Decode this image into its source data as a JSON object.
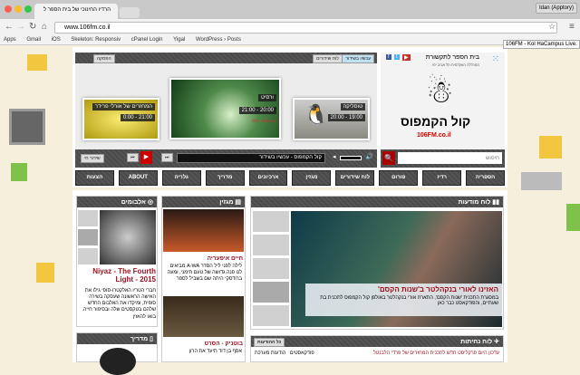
{
  "browser": {
    "tab_title": "הרדיו החינוכי של בית הספר ל",
    "user": "Idan (Apptory)",
    "url": "www.106fm.co.il",
    "tooltip": "106FM - Kol HaCampus Live.",
    "bookmarks": [
      "Apps",
      "Gmail",
      "iOS",
      "Skeleton: Responsiv",
      "cPanel Login",
      "Yigal",
      "WordPress › Posts"
    ]
  },
  "player": {
    "top_left_btn": "הפסקה",
    "top_tabs": [
      "עכשיו בשידור",
      "לוח שידורים"
    ],
    "slides": [
      {
        "title": "המחזרים של אורלי פרידר",
        "time": "21:00 - 0:00"
      },
      {
        "title": "ורסיט",
        "time": "20:00 - 21:00",
        "host": "עם אשר בלס"
      },
      {
        "title": "טוסליקה",
        "time": "19:00 - 20:00"
      }
    ],
    "live_btn": "שידור חי",
    "track": "קול הקמפוס - עכשיו בשידור"
  },
  "logo": {
    "school": "בית הספר לתקשורת",
    "school_sub": "המכללה האקדמית תל אביב יפו",
    "brand": "קול הקמפוס",
    "site": "106FM.co.il"
  },
  "search": {
    "placeholder": "חיפוש"
  },
  "nav": [
    "הספריה",
    "רדיו",
    "פורום",
    "לוח שידורים",
    "מגזין",
    "ארכיונים",
    "מדריך",
    "גלריה",
    "ABOUT",
    "הצעות"
  ],
  "albums": {
    "title": "אלבומים",
    "headline": "Niyaz - The Fourth Light - 2015",
    "text": "חברי הטריו האלקטרו-סופי גילו את האישה הראשונה שעסקה בשירה סופית, ומיקדו את האלבום החדש שלהם בטקסטים שלה ובסיפור חייה. בואו להאזין"
  },
  "guide": {
    "title": "מדריך"
  },
  "magazine": {
    "title": "מגזין",
    "items": [
      {
        "headline": "חיים איפעריה",
        "text": "לילה לפני ליל הסדר A-WA מביאים לנו פנה גדושה של טעם תימני, ומעה ברודסקי היתה שם בשביל לספר"
      },
      {
        "headline": "בוטניק - הסרט",
        "text": "אסף בן דוד תיעד את הרון"
      }
    ]
  },
  "featured": {
    "title": "לוח מודעות",
    "headline": "האזינו לאורי בנקהלטר ב'שנות הקסם'",
    "text": "במסגרת התכנית 'שנות הקסם', התארח אורי בנקהלטר באולפן קול הקמפוס לתכנית בת שעתיים, והפודקאסט כבר כאן"
  },
  "landings": {
    "title": "לוח נחיתות",
    "all_btn": "כל ההודעות",
    "item": "עדכון היום פרקליסט חדש לתכנית המחזרים של פרדי הלבנטל",
    "filters": [
      "פודקאסטים",
      "הודעות מערכת"
    ]
  },
  "colors": {
    "accent": "#a01020",
    "dark": "#4a4a4a"
  }
}
